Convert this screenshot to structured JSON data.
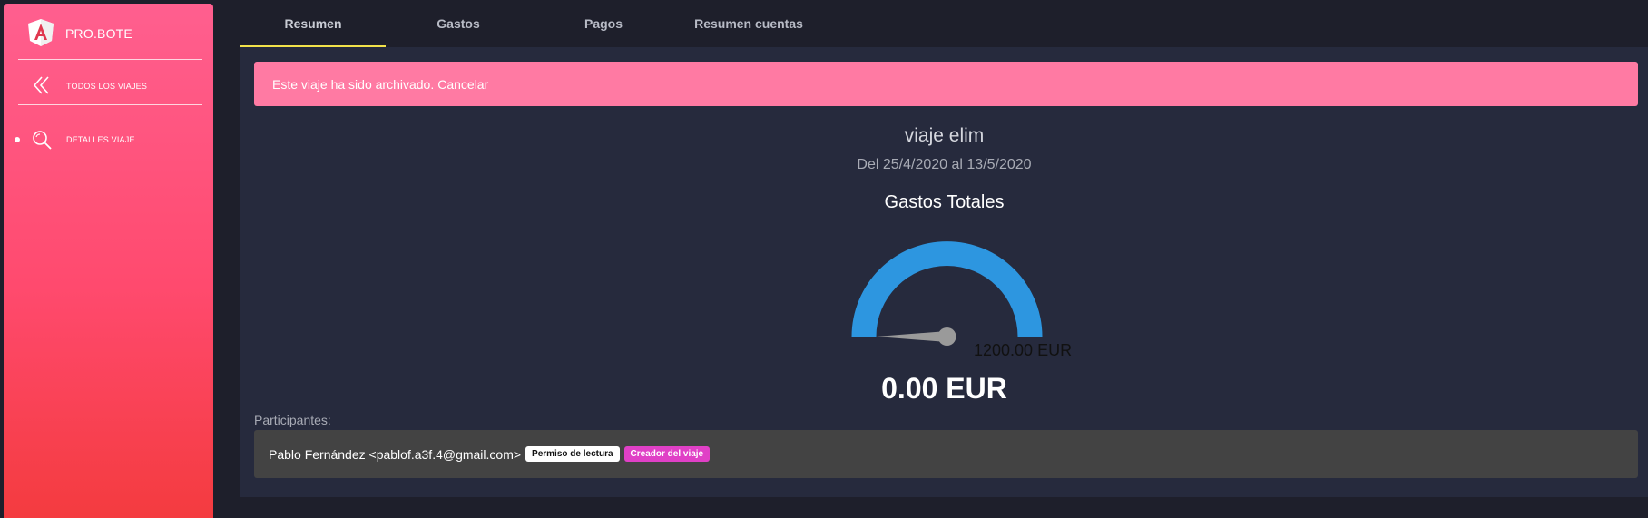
{
  "app": {
    "brand_name": "PRO.BOTE"
  },
  "sidebar": {
    "items": [
      {
        "label": "TODOS LOS VIAJES",
        "icon": "double-chevron-left-icon"
      },
      {
        "label": "DETALLES VIAJE",
        "icon": "search-icon"
      }
    ]
  },
  "tabs": [
    {
      "label": "Resumen",
      "active": true
    },
    {
      "label": "Gastos",
      "active": false
    },
    {
      "label": "Pagos",
      "active": false
    },
    {
      "label": "Resumen cuentas",
      "active": false
    }
  ],
  "alert": {
    "text": "Este viaje ha sido archivado.",
    "link": "Cancelar"
  },
  "trip": {
    "title": "viaje elim",
    "dates": "Del 25/4/2020 al 13/5/2020"
  },
  "gauge": {
    "title": "Gastos Totales",
    "max_label": "1200.00 EUR",
    "value_label": "0.00 EUR",
    "value": 0,
    "max": 1200,
    "color": "#2d96e0",
    "needle_color": "#9a9a9a"
  },
  "participants": {
    "label": "Participantes:",
    "items": [
      {
        "name": "Pablo Fernández <pablof.a3f.4@gmail.com>",
        "badges": [
          "Permiso de lectura",
          "Creador del viaje"
        ]
      }
    ]
  },
  "colors": {
    "sidebar_top": "#ff5f8f",
    "sidebar_bottom": "#f43b3f",
    "alert_bg": "#ff7aa3",
    "tab_indicator": "#f2e24a",
    "creator_badge": "#e040c6"
  }
}
